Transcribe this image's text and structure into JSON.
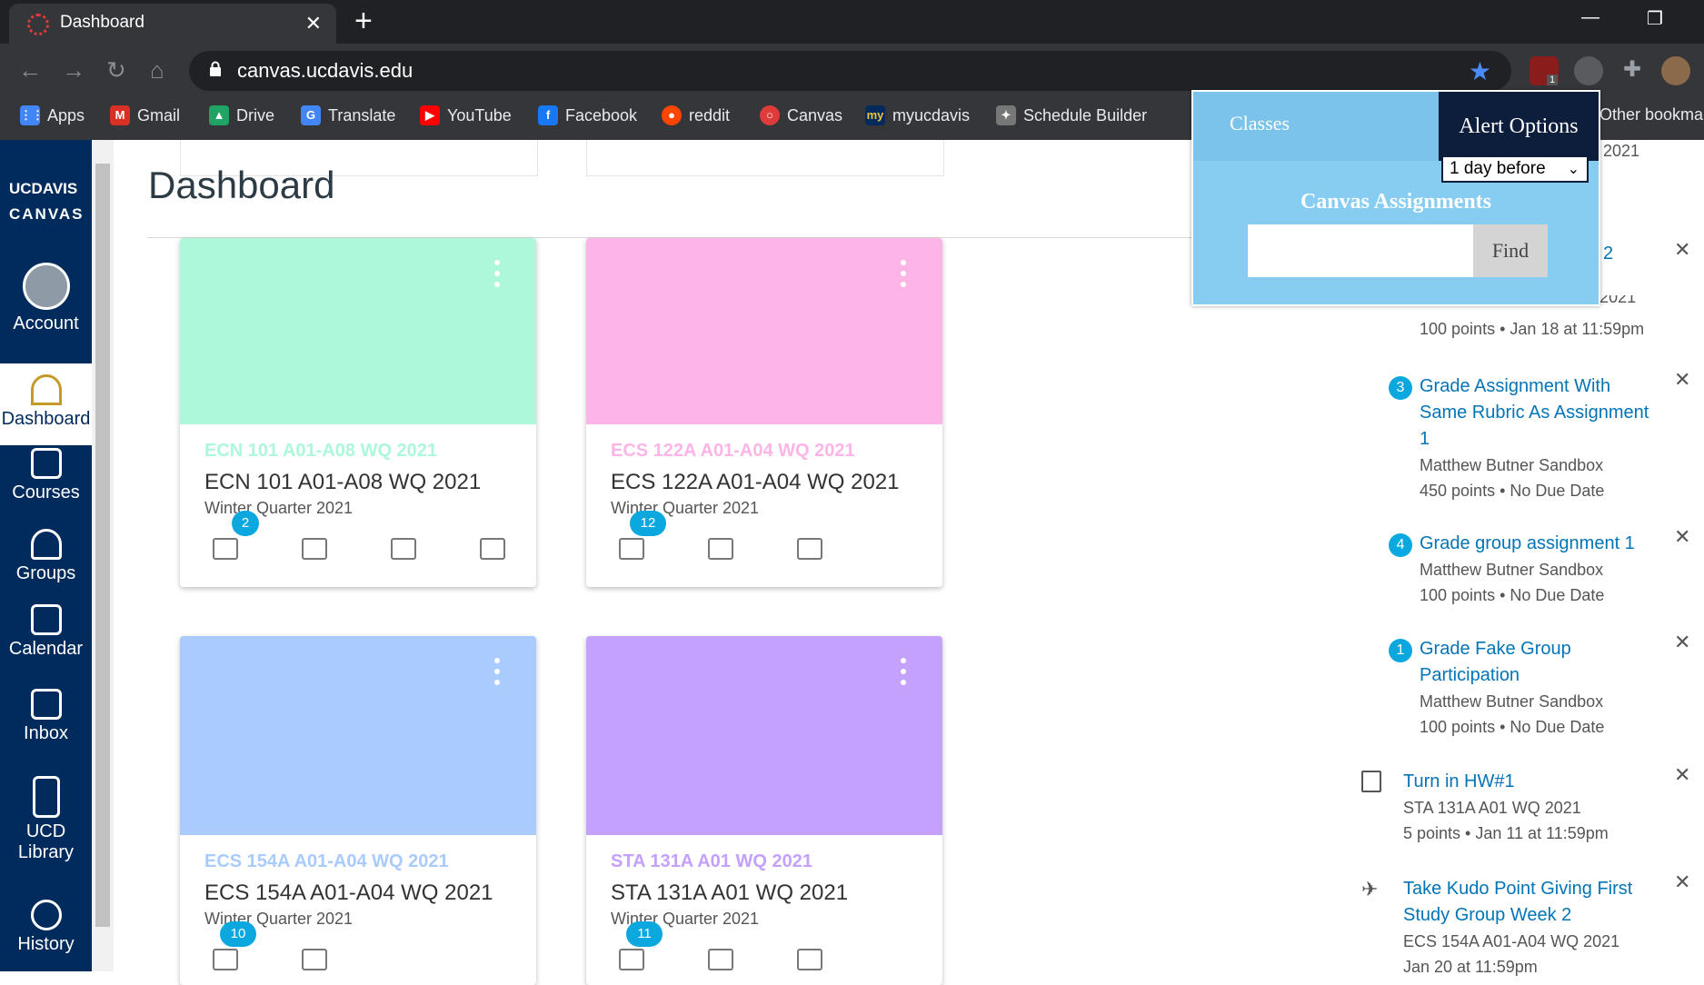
{
  "browser": {
    "tab_title": "Dashboard",
    "url": "canvas.ucdavis.edu",
    "ext_badge": "1",
    "bookmarks": [
      "Apps",
      "Gmail",
      "Drive",
      "Translate",
      "YouTube",
      "Facebook",
      "reddit",
      "Canvas",
      "myucdavis",
      "Schedule Builder"
    ],
    "other_bookmarks": "Other bookma"
  },
  "gnav": {
    "logo_line1": "UCDAVIS",
    "logo_line2": "CANVAS",
    "items": [
      "Account",
      "Dashboard",
      "Courses",
      "Groups",
      "Calendar",
      "Inbox",
      "UCD Library",
      "History"
    ]
  },
  "page": {
    "title": "Dashboard"
  },
  "cards": [
    {
      "tag": "ECN 101 A01-A08 WQ 2021",
      "name": "ECN 101 A01-A08 WQ 2021",
      "term": "Winter Quarter 2021",
      "badge": "2",
      "color": "#adf7da"
    },
    {
      "tag": "ECS 122A A01-A04 WQ 2021",
      "name": "ECS 122A A01-A04 WQ 2021",
      "term": "Winter Quarter 2021",
      "badge": "12",
      "color": "#fdb5e7"
    },
    {
      "tag": "ECS 154A A01-A04 WQ 2021",
      "name": "ECS 154A A01-A04 WQ 2021",
      "term": "Winter Quarter 2021",
      "badge": "10",
      "color": "#a9cbfd"
    },
    {
      "tag": "STA 131A A01 WQ 2021",
      "name": "STA 131A A01 WQ 2021",
      "term": "Winter Quarter 2021",
      "badge": "11",
      "color": "#c4a1fd"
    }
  ],
  "todo": {
    "partial_top": "2021",
    "partial_link": "2",
    "partial_course": "ECS 036A A01-A04 WQ 2021",
    "partial_meta": "100 points • Jan 18 at 11:59pm",
    "items": [
      {
        "num": "3",
        "title": "Grade Assignment With Same Rubric As Assignment 1",
        "course": "Matthew Butner Sandbox",
        "meta": "450 points • No Due Date"
      },
      {
        "num": "4",
        "title": "Grade group assignment 1",
        "course": "Matthew Butner Sandbox",
        "meta": "100 points • No Due Date"
      },
      {
        "num": "1",
        "title": "Grade Fake Group Participation",
        "course": "Matthew Butner Sandbox",
        "meta": "100 points • No Due Date"
      },
      {
        "title": "Turn in HW#1",
        "course": "STA 131A A01 WQ 2021",
        "meta": "5 points • Jan 11 at 11:59pm"
      },
      {
        "title": "Take Kudo Point Giving First Study Group Week 2",
        "course": "ECS 154A A01-A04 WQ 2021",
        "meta": "Jan 20 at 11:59pm"
      }
    ]
  },
  "popup": {
    "tab_classes": "Classes",
    "tab_alert": "Alert Options",
    "select_value": "1 day before",
    "heading": "Canvas Assignments",
    "input_value": "",
    "find_label": "Find"
  }
}
